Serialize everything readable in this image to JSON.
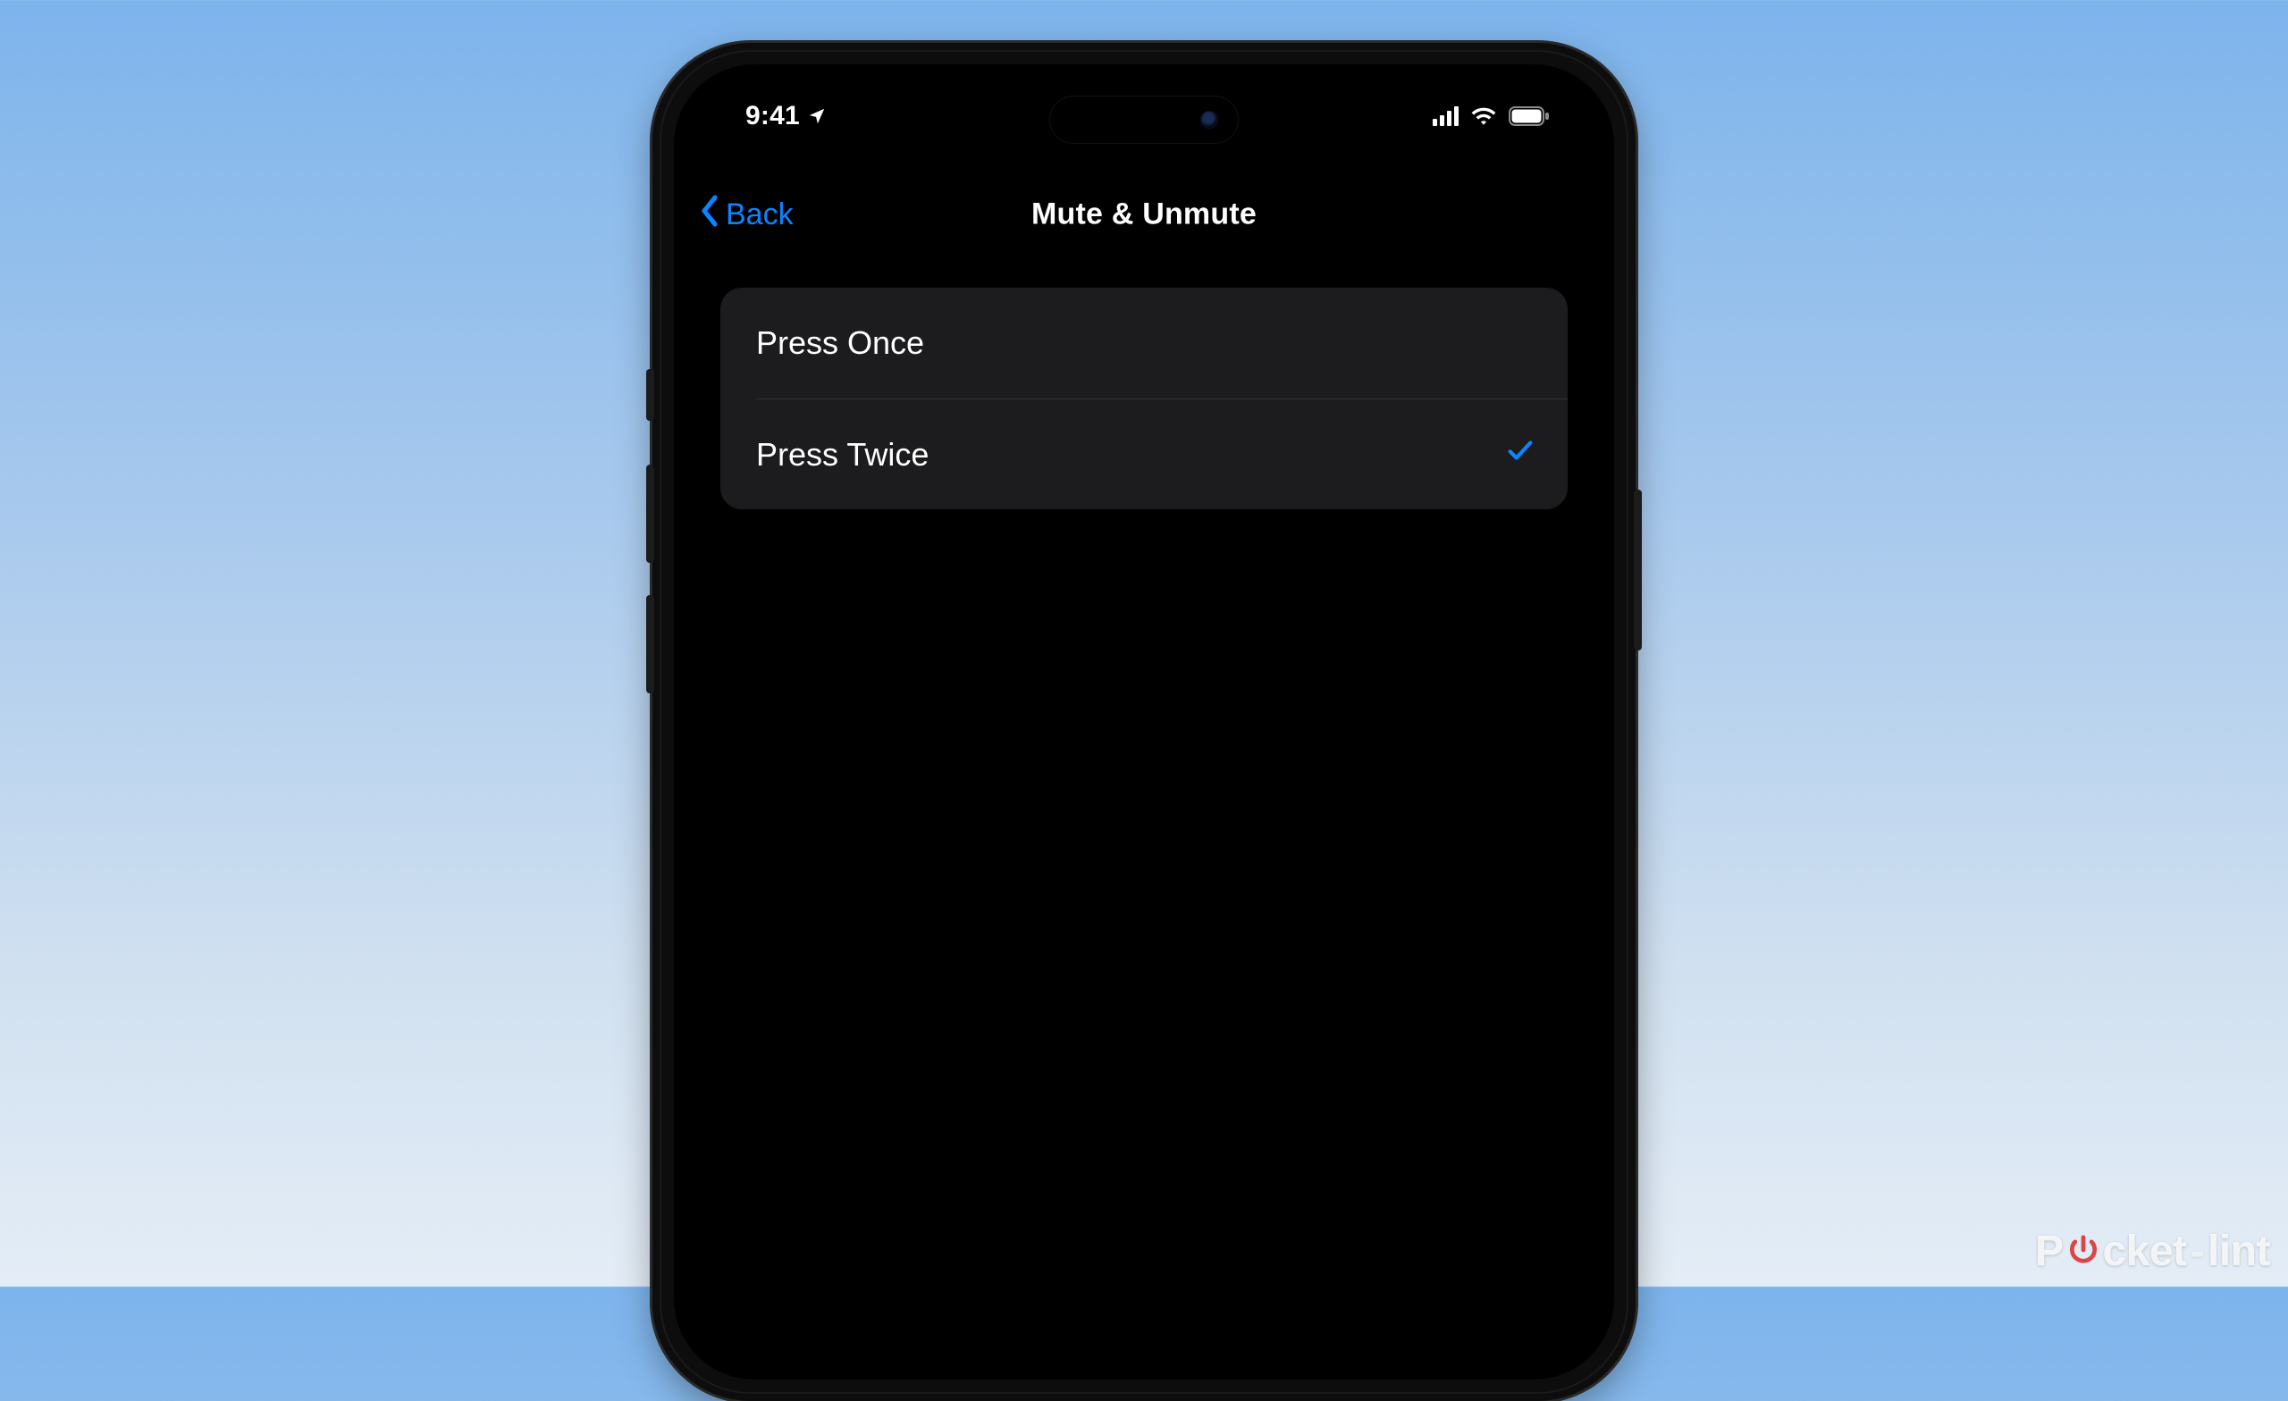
{
  "colors": {
    "accent": "#0a84ff",
    "row_bg": "#1c1c1e"
  },
  "status": {
    "time": "9:41"
  },
  "nav": {
    "back_label": "Back",
    "title": "Mute & Unmute"
  },
  "options": [
    {
      "label": "Press Once",
      "selected": false
    },
    {
      "label": "Press Twice",
      "selected": true
    }
  ],
  "watermark": {
    "prefix": "P",
    "mid": "cket",
    "suffix": "lint"
  }
}
